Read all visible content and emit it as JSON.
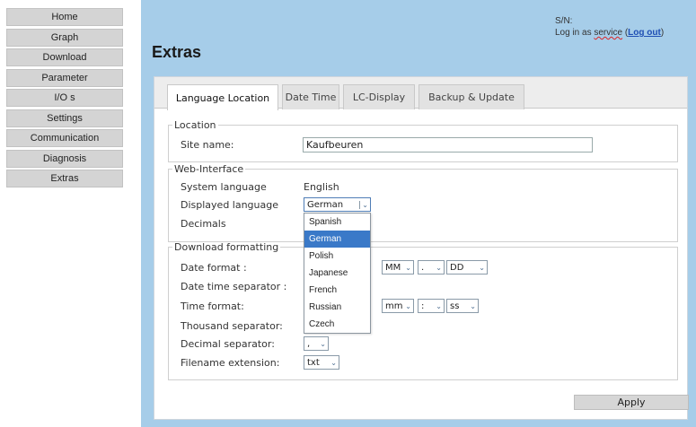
{
  "nav": {
    "items": [
      "Home",
      "Graph",
      "Download",
      "Parameter",
      "I/O s",
      "Settings",
      "Communication",
      "Diagnosis",
      "Extras"
    ]
  },
  "header": {
    "title": "Extras",
    "serial_label": "S/N:",
    "login_prefix": "Log in as ",
    "login_service": "service",
    "login_open": " (",
    "logout_label": "Log out",
    "login_close": ")"
  },
  "tabs": [
    "Language Location",
    "Date Time",
    "LC-Display",
    "Backup & Update"
  ],
  "location": {
    "legend": "Location",
    "site_name_label": "Site name:",
    "site_name_value": "Kaufbeuren"
  },
  "web": {
    "legend": "Web-Interface",
    "system_language_label": "System language",
    "system_language_value": "English",
    "displayed_language_label": "Displayed language",
    "displayed_language_value": "German",
    "decimals_label": "Decimals",
    "options": [
      "Spanish",
      "German",
      "Polish",
      "Japanese",
      "French",
      "Russian",
      "Czech"
    ],
    "selected_option": "German"
  },
  "download": {
    "legend": "Download formatting",
    "date_format_label": "Date format :",
    "date_format_part2": "MM",
    "date_format_sep": ".",
    "date_format_part3": "DD",
    "date_time_sep_label": "Date time separator :",
    "time_format_label": "Time format:",
    "time_format_part2": "mm",
    "time_format_sep": ":",
    "time_format_part3": "ss",
    "thousand_sep_label": "Thousand separator:",
    "decimal_sep_label": "Decimal separator:",
    "decimal_sep_value": ",",
    "filename_ext_label": "Filename extension:",
    "filename_ext_value": "txt"
  },
  "actions": {
    "apply_label": "Apply"
  },
  "colors": {
    "panel_bg": "#a6cde9",
    "nav_bg": "#d4d4d4",
    "selected_option_bg": "#3a79c8",
    "link": "#1e4fb4"
  }
}
